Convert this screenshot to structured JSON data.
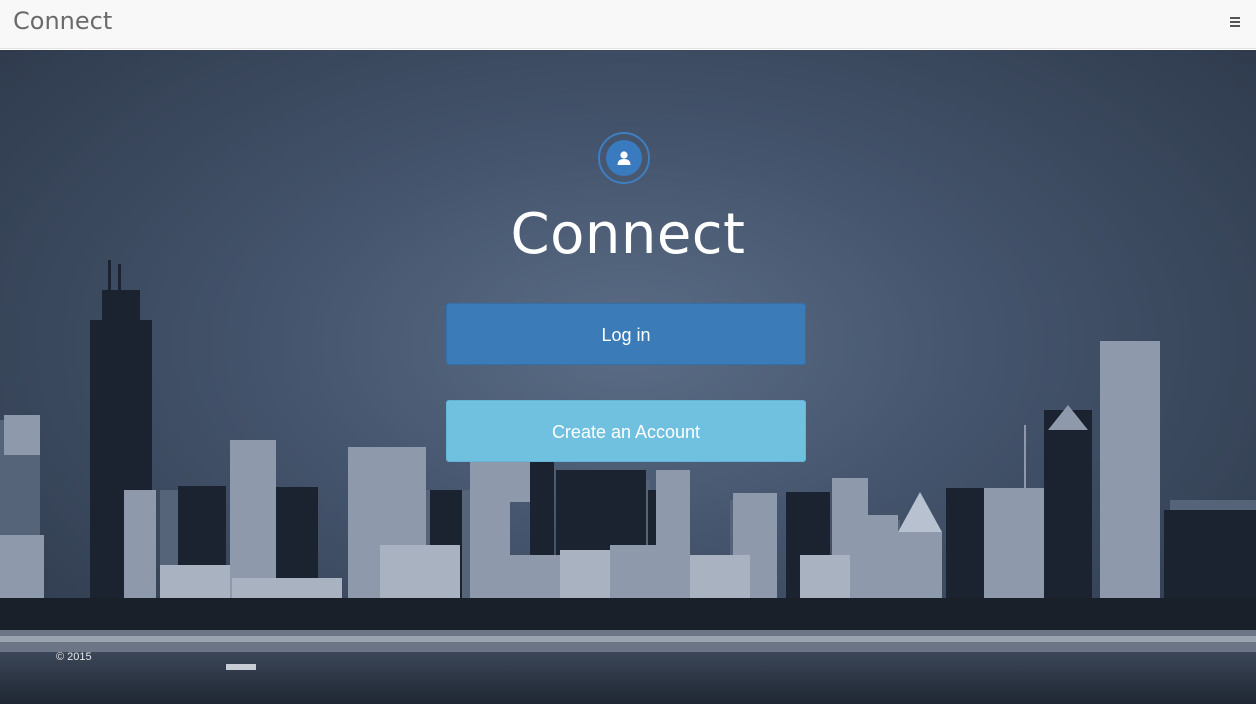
{
  "navbar": {
    "brand": "Connect",
    "menu_icon": "hamburger-menu-icon"
  },
  "hero": {
    "avatar_icon": "user-icon",
    "title": "Connect",
    "login_label": "Log in",
    "create_account_label": "Create an Account"
  },
  "footer": {
    "copyright": "© 2015"
  },
  "colors": {
    "login_button": "#3a7bb8",
    "create_button": "#70c0df",
    "avatar": "#3a7bbf",
    "navbar_bg": "#f8f8f8"
  }
}
